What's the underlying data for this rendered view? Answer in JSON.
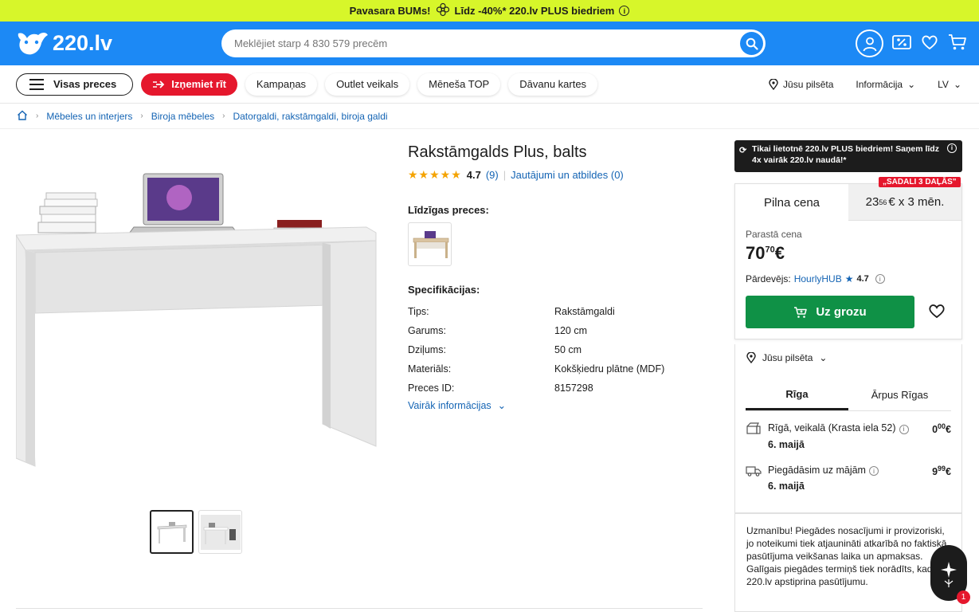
{
  "promo": {
    "text": "Pavasara BUMs! ",
    "text2": "Līdz -40%* 220.lv PLUS biedriem"
  },
  "header": {
    "logo": "220.lv",
    "search_placeholder": "Meklējiet starp 4 830 579 precēm"
  },
  "nav": {
    "all": "Visas preces",
    "pickup": "Izņemiet rīt",
    "items": [
      "Kampaņas",
      "Outlet veikals",
      "Mēneša TOP",
      "Dāvanu kartes"
    ],
    "city": "Jūsu pilsēta",
    "info": "Informācija",
    "lang": "LV"
  },
  "breadcrumb": [
    "Mēbeles un interjers",
    "Biroja mēbeles",
    "Datorgaldi, rakstāmgaldi, biroja galdi"
  ],
  "product": {
    "title": "Rakstāmgalds Plus, balts",
    "rating": "4.7",
    "reviews": "(9)",
    "qa": "Jautājumi un atbildes (0)",
    "similar_label": "Līdzīgas preces:",
    "specs_label": "Specifikācijas:",
    "specs": [
      {
        "k": "Tips:",
        "v": "Rakstāmgaldi"
      },
      {
        "k": "Garums:",
        "v": "120 cm"
      },
      {
        "k": "Dziļums:",
        "v": "50 cm"
      },
      {
        "k": "Materiāls:",
        "v": "Kokšķiedru plātne (MDF)"
      },
      {
        "k": "Preces ID:",
        "v": "8157298"
      }
    ],
    "more": "Vairāk informācijas"
  },
  "plus_banner": "Tikai lietotnē 220.lv PLUS biedriem! Saņem līdz 4x vairāk 220.lv naudā!*",
  "price": {
    "tab_full": "Pilna cena",
    "badge": "„SADALI 3 DAĻĀS\"",
    "inst_int": "23",
    "inst_dec": "56",
    "inst_rest": "€ x 3 mēn.",
    "old_label": "Parastā cena",
    "int": "70",
    "dec": "70",
    "cur": "€",
    "seller_label": "Pārdevējs:",
    "seller": "HourlyHUB",
    "seller_rating": "4.7",
    "cart": "Uz grozu"
  },
  "delivery": {
    "city": "Jūsu pilsēta",
    "tab1": "Rīga",
    "tab2": "Ārpus Rīgas",
    "opt1": "Rīgā, veikalā (Krasta iela 52)",
    "opt1_date": "6. maijā",
    "opt1_int": "0",
    "opt1_dec": "00",
    "opt2": "Piegādāsim uz mājām",
    "opt2_date": "6. maijā",
    "opt2_int": "9",
    "opt2_dec": "99",
    "cur": "€"
  },
  "warning": "Uzmanību! Piegādes nosacījumi ir provizoriski, jo noteikumi tiek atjaunināti atkarībā no faktiskā pasūtījuma veikšanas laika un apmaksas. Galīgais piegādes termiņš tiek norādīts, kad 220.lv apstiprina pasūtījumu.",
  "chat_count": "1",
  "colors": {
    "brand": "#1c89f5",
    "promo": "#d7f62a",
    "cart": "#0f9146",
    "sale": "#e5172d"
  }
}
